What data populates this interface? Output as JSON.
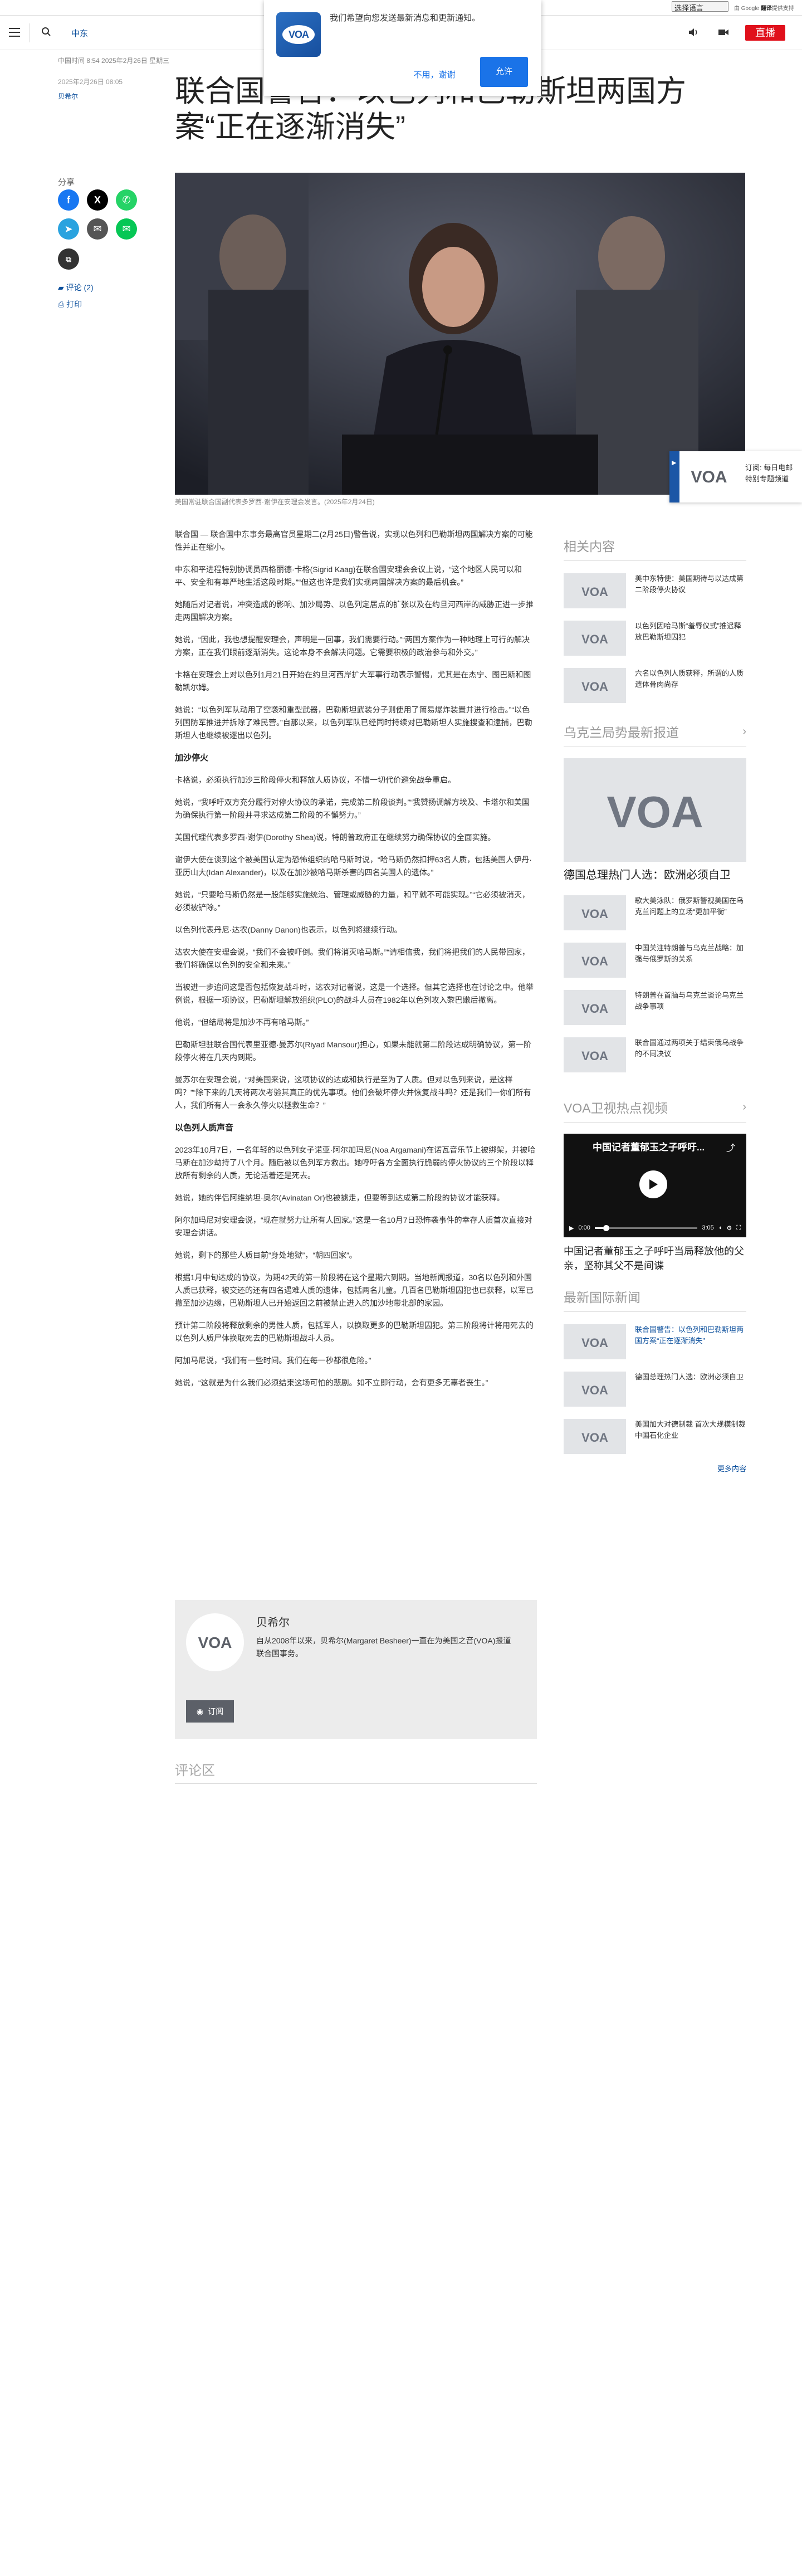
{
  "topbar": {
    "language_select": "选择语言",
    "translate_text": "由 Google",
    "translate_brand": "翻译",
    "translate_suffix": "提供支持"
  },
  "header": {
    "section": "中东",
    "live": "直播"
  },
  "notification": {
    "text": "我们希望向您发送最新消息和更新通知。",
    "deny": "不用，谢谢",
    "allow": "允许",
    "logo_text": "VOA"
  },
  "article": {
    "meta_top": "中国时间 8:54 2025年2月26日 星期三",
    "date": "2025年2月26日 08:05",
    "author": "贝希尔",
    "title": "联合国警告：以色列和巴勒斯坦两国方案“正在逐渐消失”",
    "caption": "美国常驻联合国副代表多罗西·谢伊在安理会发言。(2025年2月24日)",
    "paragraphs": [
      "联合国 — 联合国中东事务最高官员星期二(2月25日)警告说，实现以色列和巴勒斯坦两国解决方案的可能性并正在缩小。",
      "中东和平进程特别协调员西格丽德·卡格(Sigrid Kaag)在联合国安理会会议上说，“这个地区人民可以和平、安全和有尊严地生活这段时期。”“但这也许是我们实现两国解决方案的最后机会。”",
      "她随后对记者说，冲突造成的影响、加沙局势、以色列定居点的扩张以及在约旦河西岸的威胁正进一步推走两国解决方案。",
      "她说，“因此，我也想提醒安理会，声明是一回事，我们需要行动。”“两国方案作为一种地理上可行的解决方案，正在我们眼前逐渐消失。这论本身不会解决问题。它需要积极的政治参与和外交。”",
      "卡格在安理会上对以色列1月21日开始在约旦河西岸扩大军事行动表示警惕，尤其是在杰宁、图巴斯和图勒凯尔姆。",
      "她说：“以色列军队动用了空袭和重型武器，巴勒斯坦武装分子则使用了简易爆炸装置并进行枪击。”“以色列国防军推进并拆除了难民营。”自那以来，以色列军队已经同时持续对巴勒斯坦人实施搜查和逮捕，巴勒斯坦人也继续被逐出以色列。",
      "加沙停火",
      "卡格说，必须执行加沙三阶段停火和释放人质协议，不惜一切代价避免战争重启。",
      "她说，“我呼吁双方充分履行对停火协议的承诺，完成第二阶段谈判。”“我赞扬调解方埃及、卡塔尔和美国为确保执行第一阶段并寻求达成第二阶段的不懈努力。”",
      "美国代理代表多罗西·谢伊(Dorothy Shea)说，特朗普政府正在继续努力确保协议的全面实施。",
      "谢伊大使在谈到这个被美国认定为恐怖组织的哈马斯时说，“哈马斯仍然扣押63名人质，包括美国人伊丹·亚历山大(Idan Alexander)，以及在加沙被哈马斯杀害的四名美国人的遗体。”",
      "她说，“只要哈马斯仍然是一股能够实施统治、管理或威胁的力量，和平就不可能实现。”“它必须被消灭，必须被铲除。”",
      "以色列代表丹尼·达农(Danny Danon)也表示，以色列将继续行动。",
      "达农大使在安理会说，“我们不会被吓倒。我们将消灭哈马斯。”“请相信我，我们将把我们的人民带回家，我们将确保以色列的安全和未来。”",
      "当被进一步追问这是否包括恢复战斗时，达农对记者说，这是一个选择。但其它选择也在讨论之中。他举例说，根据一项协议，巴勒斯坦解放组织(PLO)的战斗人员在1982年以色列攻入黎巴嫩后撤离。",
      "他说，“但结局将是加沙不再有哈马斯。”",
      "巴勒斯坦驻联合国代表里亚德·曼苏尔(Riyad Mansour)担心，如果未能就第二阶段达成明确协议，第一阶段停火将在几天内到期。",
      "曼苏尔在安理会说，“对美国来说，这项协议的达成和执行是至为了人质。但对以色列来说，是这样吗？”“除下来的几天将两次考验其真正的优先事项。他们会破坏停火并恢复战斗吗？还是我们一你们所有人，我们所有人一会永久停火以拯救生命？”",
      "以色列人质声音",
      "2023年10月7日，一名年轻的以色列女子诺亚·阿尔加玛尼(Noa Argamani)在诺瓦音乐节上被绑架，并被哈马斯在加沙劫持了八个月。随后被以色列军方救出。她呼吁各方全面执行脆弱的停火协议的三个阶段以释放所有剩余的人质，无论活着还是死去。",
      "她说，她的伴侣阿维纳坦·奥尔(Avinatan Or)也被掳走，但要等到达成第二阶段的协议才能获释。",
      "阿尔加玛尼对安理会说，“现在就努力让所有人回家。”这是一名10月7日恐怖袭事件的幸存人质首次直接对安理会讲话。",
      "她说，剩下的那些人质目前“身处地狱”，“朝四回家”。",
      "根据1月中旬达成的协议，为期42天的第一阶段将在这个星期六到期。当地新闻报道，30名以色列和外国人质已获释，被交还的还有四名遇难人质的遗体，包括两名儿童。几百名巴勒斯坦囚犯也已获释，以军已撤至加沙边缘，巴勒斯坦人已开始返回之前被禁止进入的加沙地带北部的家园。",
      "预计第二阶段将释放剩余的男性人质，包括军人，以换取更多的巴勒斯坦囚犯。第三阶段将计将用死去的以色列人质尸体换取死去的巴勒斯坦战斗人员。",
      "阿加马尼说，“我们有一些时间。我们在每一秒都很危险。”",
      "她说，“这就是为什么我们必须结束这场可怕的悲剧。如不立即行动，会有更多无辜者丧生。”"
    ],
    "author_box": {
      "name": "贝希尔",
      "bio": "自从2008年以来，贝希尔(Margaret Besheer)一直在为美国之音(VOA)报道联合国事务。",
      "subscribe": "订阅"
    },
    "comments_title": "评论区"
  },
  "share": {
    "label": "分享",
    "comments_link": "评论 (2)",
    "print_link": "打印"
  },
  "sticky": {
    "line1": "订阅: 每日电邮",
    "line2": "特别专题频道"
  },
  "sidebar": {
    "related_title": "相关内容",
    "related": [
      "美中东特使：美国期待与以达成第二阶段停火协议",
      "以色列因哈马斯“羞辱仪式”推迟释放巴勒斯坦囚犯",
      "六名以色列人质获释，所谓的人质遗体骨肉尚存"
    ],
    "ukraine_title": "乌克兰局势最新报道",
    "ukraine_big": "德国总理热门人选：欧洲必须自卫",
    "ukraine": [
      "歌大美泳队：俄罗斯警视美国在乌克兰问题上的立场“更加平衡”",
      "中国关注特朗普与乌克兰战略：加强与俄罗斯的关系",
      "特朗普在首脑与乌克兰谈论乌克兰战争事项",
      "联合国通过两项关于结束俄乌战争的不同决议"
    ],
    "video_title": "VOA卫视热点视频",
    "video_overlay": "中国记者董郁玉之子呼吁...",
    "video_time": "0:00",
    "video_duration": "3:05",
    "video_caption": "中国记者董郁玉之子呼吁当局释放他的父亲，坚称其父不是间谍",
    "intl_title": "最新国际新闻",
    "intl": [
      "联合国警告：以色列和巴勒斯坦两国方案“正在逐渐消失”",
      "德国总理热门人选：欧洲必须自卫",
      "美国加大对德制裁 首次大规模制裁中国石化企业"
    ],
    "more": "更多内容"
  }
}
